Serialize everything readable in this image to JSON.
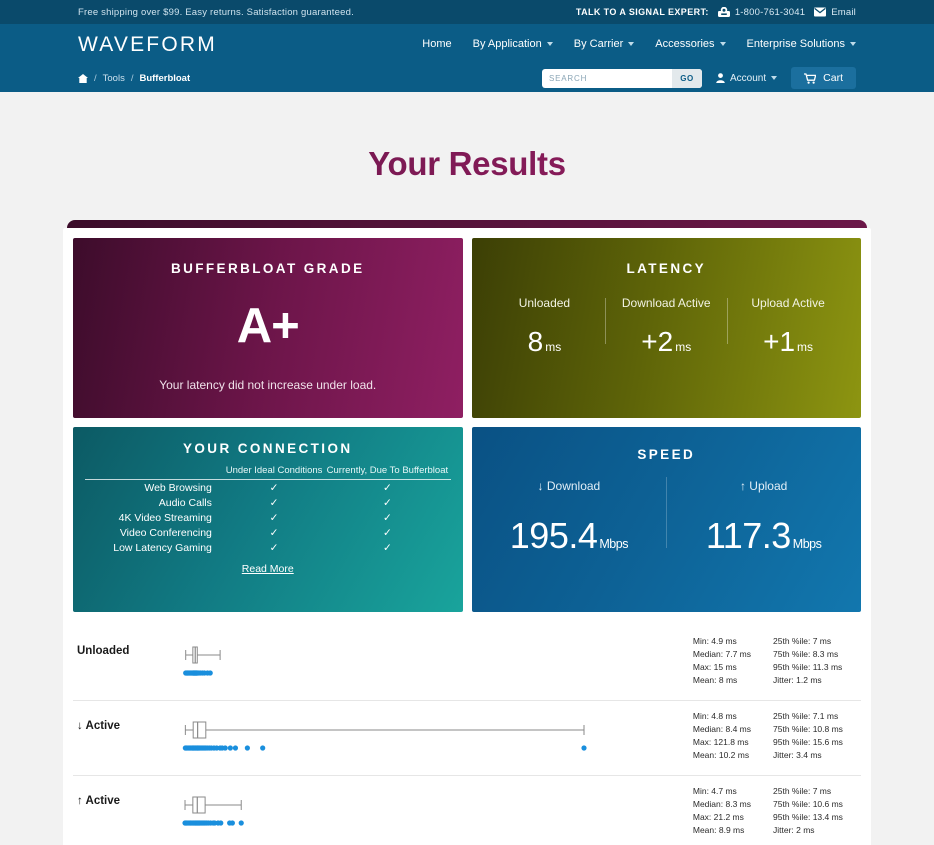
{
  "utility_bar": {
    "shipping_note": "Free shipping over $99. Easy returns. Satisfaction guaranteed.",
    "expert_label": "TALK TO A SIGNAL EXPERT:",
    "phone": "1-800-761-3041",
    "email_label": "Email"
  },
  "nav": {
    "brand": "WAVEFORM",
    "links": [
      {
        "label": "Home",
        "has_caret": false
      },
      {
        "label": "By Application",
        "has_caret": true
      },
      {
        "label": "By Carrier",
        "has_caret": true
      },
      {
        "label": "Accessories",
        "has_caret": true
      },
      {
        "label": "Enterprise Solutions",
        "has_caret": true
      }
    ]
  },
  "subnav": {
    "breadcrumb": {
      "home": "Home",
      "items": [
        "Tools",
        "Bufferbloat"
      ]
    },
    "search": {
      "placeholder": "SEARCH",
      "value": "",
      "go_label": "GO"
    },
    "account_label": "Account",
    "cart_label": "Cart"
  },
  "page": {
    "title": "Your Results"
  },
  "grade_card": {
    "title": "BUFFERBLOAT GRADE",
    "grade": "A+",
    "subtitle": "Your latency did not increase under load.",
    "color": "#6c1549"
  },
  "latency_card": {
    "title": "LATENCY",
    "columns": [
      {
        "label": "Unloaded",
        "value": "8",
        "unit": "ms"
      },
      {
        "label": "Download Active",
        "value": "+2",
        "unit": "ms"
      },
      {
        "label": "Upload Active",
        "value": "+1",
        "unit": "ms"
      }
    ],
    "color": "#5e6408"
  },
  "connection_card": {
    "title": "YOUR CONNECTION",
    "headers": [
      "",
      "Under Ideal Conditions",
      "Currently, Due To Bufferbloat"
    ],
    "rows": [
      {
        "feature": "Web Browsing",
        "ideal": "✓",
        "current": "✓"
      },
      {
        "feature": "Audio Calls",
        "ideal": "✓",
        "current": "✓"
      },
      {
        "feature": "4K Video Streaming",
        "ideal": "✓",
        "current": "✓"
      },
      {
        "feature": "Video Conferencing",
        "ideal": "✓",
        "current": "✓"
      },
      {
        "feature": "Low Latency Gaming",
        "ideal": "✓",
        "current": "✓"
      }
    ],
    "read_more": "Read More",
    "color": "#117a83"
  },
  "speed_card": {
    "title": "SPEED",
    "download": {
      "label": "↓ Download",
      "value": "195.4",
      "unit": "Mbps"
    },
    "upload": {
      "label": "↑ Upload",
      "value": "117.3",
      "unit": "Mbps"
    },
    "color": "#0d6195"
  },
  "plots": [
    {
      "label": "Unloaded",
      "stats_left": [
        "Min: 4.9 ms",
        "Median: 7.7 ms",
        "Max: 15 ms",
        "Mean: 8 ms"
      ],
      "stats_right": [
        "25th %ile: 7 ms",
        "75th %ile: 8.3 ms",
        "95th %ile: 11.3 ms",
        "Jitter: 1.2 ms"
      ],
      "box": {
        "min": 4.9,
        "q1": 7.0,
        "median": 7.7,
        "q3": 8.3,
        "max": 15
      },
      "scatter": [
        4.9,
        5.1,
        5.3,
        5.4,
        5.6,
        5.8,
        6.0,
        6.2,
        6.4,
        6.6,
        6.8,
        7.0,
        7.1,
        7.2,
        7.3,
        7.4,
        7.5,
        7.6,
        7.7,
        7.8,
        7.9,
        8.0,
        8.1,
        8.2,
        8.3,
        8.5,
        8.8,
        9.2,
        9.8,
        10.4,
        11.3,
        12.1
      ],
      "axis_max": 121.8
    },
    {
      "label": "↓ Active",
      "stats_left": [
        "Min: 4.8 ms",
        "Median: 8.4 ms",
        "Max: 121.8 ms",
        "Mean: 10.2 ms"
      ],
      "stats_right": [
        "25th %ile: 7.1 ms",
        "75th %ile: 10.8 ms",
        "95th %ile: 15.6 ms",
        "Jitter: 3.4 ms"
      ],
      "box": {
        "min": 4.8,
        "q1": 7.1,
        "median": 8.4,
        "q3": 10.8,
        "max": 121.8
      },
      "scatter": [
        4.8,
        5.0,
        5.2,
        5.5,
        5.8,
        6.0,
        6.3,
        6.5,
        6.8,
        7.0,
        7.1,
        7.3,
        7.5,
        7.7,
        7.9,
        8.1,
        8.3,
        8.4,
        8.6,
        8.8,
        9.0,
        9.3,
        9.6,
        9.9,
        10.2,
        10.5,
        10.8,
        11.2,
        11.8,
        12.4,
        13.2,
        14.0,
        15.0,
        15.6,
        16.5,
        18.0,
        19.5,
        23.0,
        27.5,
        121.8
      ],
      "axis_max": 121.8
    },
    {
      "label": "↑ Active",
      "stats_left": [
        "Min: 4.7 ms",
        "Median: 8.3 ms",
        "Max: 21.2 ms",
        "Mean: 8.9 ms"
      ],
      "stats_right": [
        "25th %ile: 7 ms",
        "75th %ile: 10.6 ms",
        "95th %ile: 13.4 ms",
        "Jitter: 2 ms"
      ],
      "box": {
        "min": 4.7,
        "q1": 7.0,
        "median": 8.3,
        "q3": 10.6,
        "max": 21.2
      },
      "scatter": [
        4.7,
        4.9,
        5.1,
        5.3,
        5.6,
        5.9,
        6.2,
        6.4,
        6.7,
        7.0,
        7.2,
        7.5,
        7.7,
        7.9,
        8.1,
        8.3,
        8.5,
        8.7,
        8.9,
        9.1,
        9.4,
        9.7,
        10.0,
        10.3,
        10.6,
        11.0,
        11.5,
        12.2,
        13.0,
        13.4,
        14.4,
        15.2,
        17.8,
        18.6,
        21.2
      ],
      "axis_max": 121.8
    }
  ],
  "scatter_color": "#1a8fdd"
}
